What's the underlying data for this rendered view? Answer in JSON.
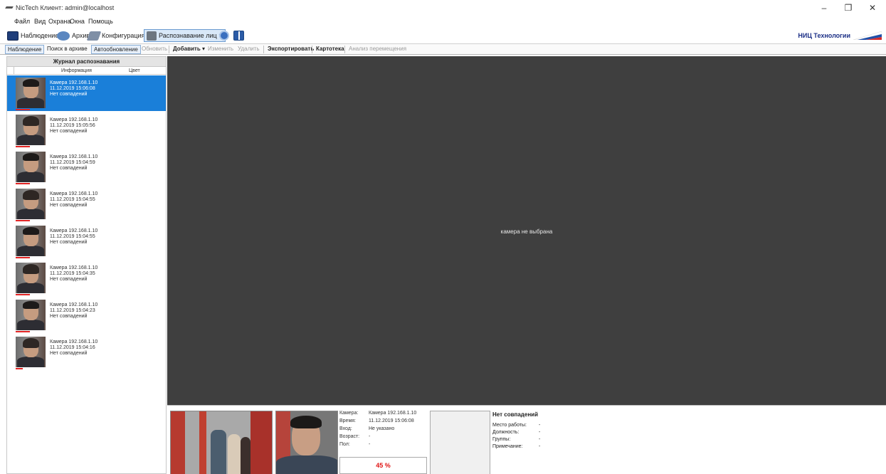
{
  "window": {
    "title": "NicTech Клиент: admin@localhost",
    "minimize": "–",
    "maximize": "❐",
    "close": "✕"
  },
  "menu": [
    "Файл",
    "Вид",
    "Охрана",
    "Окна",
    "Помощь"
  ],
  "toolbar": {
    "observe": "Наблюдение",
    "archive": "Архив",
    "config": "Конфигурация",
    "face_recognition": "Распознавание лиц",
    "dropdown_arrow": "▾",
    "brand": "НИЦ Технологии"
  },
  "toolbar2": {
    "observe": "Наблюдение",
    "search_archive": "Поиск в архиве",
    "auto_update": "Автообновление",
    "refresh": "Обновить",
    "add": "Добавить",
    "add_arrow": "▾",
    "edit": "Изменить",
    "delete": "Удалить",
    "export": "Экспортировать",
    "card_index": "Картотека",
    "movement_analysis": "Анализ перемещения"
  },
  "journal": {
    "title": "Журнал распознавания",
    "col_info": "Информация",
    "col_color": "Цвет",
    "items": [
      {
        "camera": "Камера 192.168.1.10",
        "time": "11.12.2019 15:06:08",
        "status": "Нет совпадений"
      },
      {
        "camera": "Камера 192.168.1.10",
        "time": "11.12.2019 15:05:56",
        "status": "Нет совпадений"
      },
      {
        "camera": "Камера 192.168.1.10",
        "time": "11.12.2019 15:04:59",
        "status": "Нет совпадений"
      },
      {
        "camera": "Камера 192.168.1.10",
        "time": "11.12.2019 15:04:55",
        "status": "Нет совпадений"
      },
      {
        "camera": "Камера 192.168.1.10",
        "time": "11.12.2019 15:04:55",
        "status": "Нет совпадений"
      },
      {
        "camera": "Камера 192.168.1.10",
        "time": "11.12.2019 15:04:35",
        "status": "Нет совпадений"
      },
      {
        "camera": "Камера 192.168.1.10",
        "time": "11.12.2019 15:04:23",
        "status": "Нет совпадений"
      },
      {
        "camera": "Камера 192.168.1.10",
        "time": "11.12.2019 15:04:16",
        "status": "Нет совпадений"
      }
    ]
  },
  "video": {
    "message": "камера не выбрана"
  },
  "detail": {
    "camera_label": "Камера:",
    "camera_value": "Камера 192.168.1.10",
    "time_label": "Время:",
    "time_value": "11.12.2019 15:06:08",
    "entry_label": "Вход:",
    "entry_value": "Не указано",
    "age_label": "Возраст:",
    "age_value": "-",
    "sex_label": "Пол:",
    "sex_value": "-",
    "percent": "45 %",
    "match_title": "Нет совпадений",
    "work_label": "Место работы:",
    "work_value": "-",
    "position_label": "Должность:",
    "position_value": "-",
    "groups_label": "Группы:",
    "groups_value": "-",
    "note_label": "Примечание:",
    "note_value": "-"
  },
  "colors": {
    "selection": "#1a7fd9",
    "video_bg": "#3f3f3f",
    "percent": "#e01515",
    "brand": "#1b2f86"
  }
}
